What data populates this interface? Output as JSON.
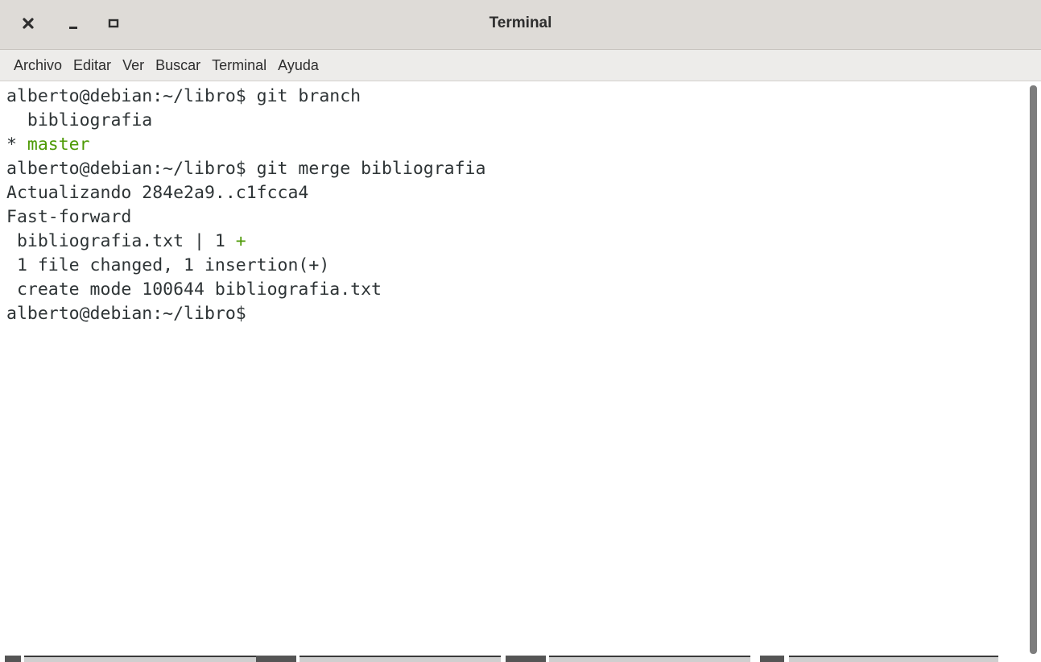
{
  "window": {
    "title": "Terminal"
  },
  "menu": {
    "items": [
      "Archivo",
      "Editar",
      "Ver",
      "Buscar",
      "Terminal",
      "Ayuda"
    ]
  },
  "terminal": {
    "lines": [
      {
        "text": "alberto@debian:~/libro$ git branch"
      },
      {
        "text": "  bibliografia"
      },
      {
        "prefix": "* ",
        "highlight": "master"
      },
      {
        "text": "alberto@debian:~/libro$ git merge bibliografia"
      },
      {
        "text": "Actualizando 284e2a9..c1fcca4"
      },
      {
        "text": "Fast-forward"
      },
      {
        "prefix": " bibliografia.txt | 1 ",
        "highlight": "+"
      },
      {
        "text": " 1 file changed, 1 insertion(+)"
      },
      {
        "text": " create mode 100644 bibliografia.txt"
      },
      {
        "text": "alberto@debian:~/libro$ "
      }
    ]
  },
  "colors": {
    "foreground": "#2e3436",
    "highlight_green": "#4e9a06",
    "titlebar": "#dedbd7",
    "menubar": "#edecea"
  },
  "icons": {
    "close": "close-icon",
    "minimize": "minimize-icon",
    "maximize": "maximize-icon"
  }
}
